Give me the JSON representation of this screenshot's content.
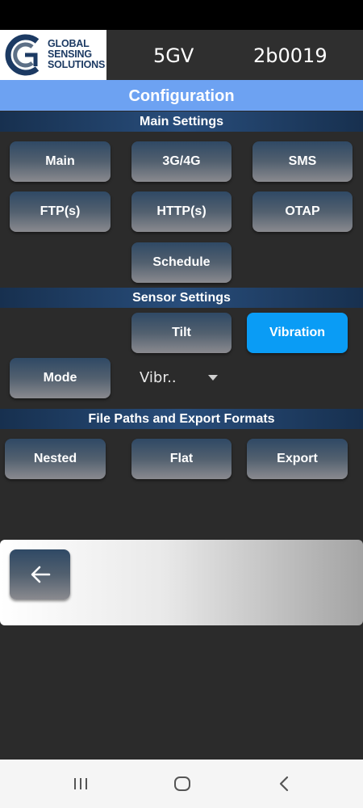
{
  "header": {
    "logo_line1": "GLOBAL",
    "logo_line2": "SENSING",
    "logo_line3": "SOLUTIONS",
    "model": "5GV",
    "device_id": "2b0019"
  },
  "config_title": "Configuration",
  "main_settings": {
    "title": "Main Settings",
    "buttons": [
      "Main",
      "3G/4G",
      "SMS",
      "FTP(s)",
      "HTTP(s)",
      "OTAP",
      "Schedule"
    ]
  },
  "sensor_settings": {
    "title": "Sensor Settings",
    "tilt_label": "Tilt",
    "vibration_label": "Vibration",
    "selected": "Vibration",
    "mode_label": "Mode",
    "mode_value": "Vibr.."
  },
  "file_paths": {
    "title": "File Paths and Export Formats",
    "buttons": [
      "Nested",
      "Flat",
      "Export"
    ]
  },
  "icons": {
    "back": "arrow-left-icon",
    "nav_recents": "recents-icon",
    "nav_home": "home-icon",
    "nav_back": "chevron-left-icon"
  },
  "colors": {
    "config_bar": "#6da2f2",
    "active_button": "#0a9cf5",
    "background": "#2b2b2b",
    "logo_text": "#1c3a63"
  }
}
